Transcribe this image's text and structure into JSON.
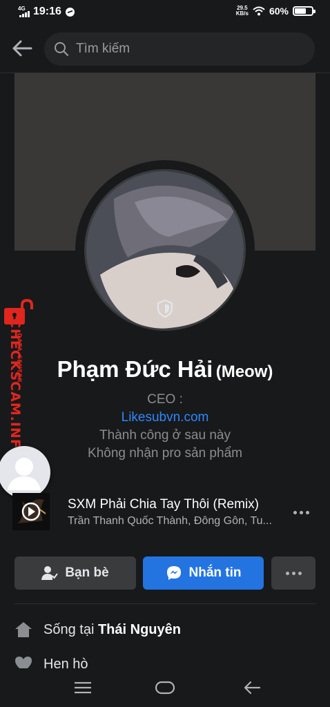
{
  "status_bar": {
    "network": "4G",
    "time": "19:16",
    "speed_value": "29.5",
    "speed_unit": "KB/s",
    "battery": "60%"
  },
  "header": {
    "search_placeholder": "Tìm kiếm"
  },
  "watermark": {
    "brand": "CHECKSCAM.INFO",
    "subtitle": "DATA CENTER"
  },
  "profile": {
    "name": "Phạm Đức Hải",
    "alternate_name": "(Meow)",
    "bio": {
      "line1": "CEO :",
      "link": "Likesubvn.com",
      "line3": "Thành công ở sau này",
      "line4": "Không nhận pro sản phẩm"
    }
  },
  "music": {
    "title": "SXM Phải Chia Tay Thôi (Remix)",
    "artist": "Trần Thanh Quốc Thành, Đông Gôn, Tu..."
  },
  "actions": {
    "friends_label": "Bạn bè",
    "message_label": "Nhắn tin"
  },
  "details": {
    "lives_prefix": "Sống tại",
    "lives_city": "Thái Nguyên",
    "dating_label": "Hẹn hò"
  },
  "colors": {
    "background": "#18191a",
    "accent_blue": "#2374e1",
    "link_blue": "#2d88ff",
    "watermark_red": "#e0261f"
  },
  "icons": [
    "back-arrow-icon",
    "search-icon",
    "shield-icon",
    "lock-icon",
    "play-icon",
    "more-icon",
    "person-icon",
    "messenger-icon",
    "home-icon",
    "heart-icon",
    "menu-icon",
    "home-pill-icon",
    "nav-back-icon"
  ]
}
